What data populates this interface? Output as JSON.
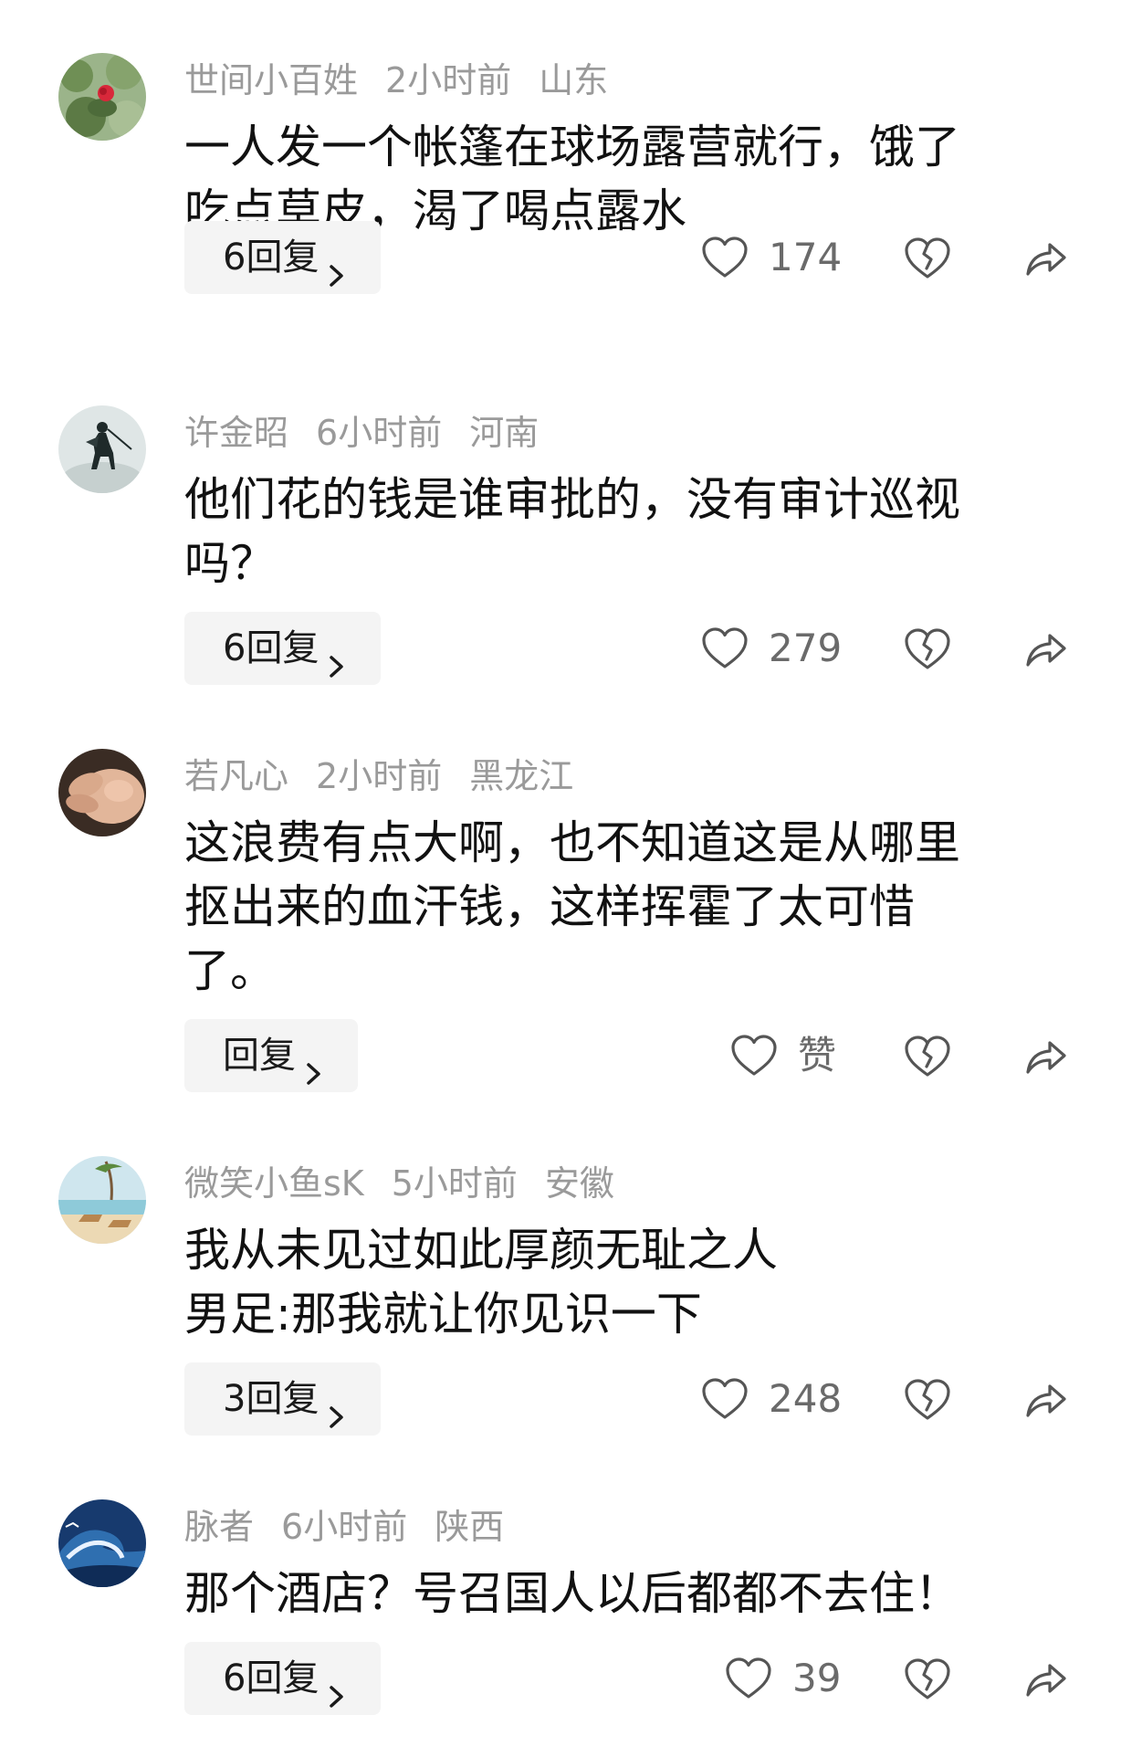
{
  "comments": [
    {
      "username": "世间小百姓",
      "time": "2小时前",
      "location": "山东",
      "text": "一人发一个帐篷在球场露营就行，饿了\n吃点草皮，渴了喝点露水",
      "reply_label": "6回复",
      "like_count": "174",
      "avatar_icon": "rose-flower-avatar"
    },
    {
      "username": "许金昭",
      "time": "6小时前",
      "location": "河南",
      "text": "他们花的钱是谁审批的，没有审计巡视\n吗？",
      "reply_label": "6回复",
      "like_count": "279",
      "avatar_icon": "horse-rider-avatar"
    },
    {
      "username": "若凡心",
      "time": "2小时前",
      "location": "黑龙江",
      "text": "这浪费有点大啊，也不知道这是从哪里\n抠出来的血汗钱，这样挥霍了太可惜\n了。",
      "reply_label": "回复",
      "like_count": "赞",
      "avatar_icon": "baby-hand-avatar"
    },
    {
      "username": "微笑小鱼sK",
      "time": "5小时前",
      "location": "安徽",
      "text": "我从未见过如此厚颜无耻之人\n男足:那我就让你见识一下",
      "reply_label": "3回复",
      "like_count": "248",
      "avatar_icon": "beach-chairs-avatar"
    },
    {
      "username": "脉者",
      "time": "6小时前",
      "location": "陕西",
      "text": "那个酒店？号召国人以后都都不去住！",
      "reply_label": "6回复",
      "like_count": "39",
      "avatar_icon": "ocean-wave-avatar"
    }
  ],
  "icons": {
    "like": "heart-outline-icon",
    "dislike": "broken-heart-icon",
    "share": "share-arrow-icon",
    "chevron": "chevron-right-icon"
  },
  "colors": {
    "meta_text": "#9a9a9a",
    "body_text": "#111111",
    "reply_bg": "#f4f4f4",
    "icon": "#555555"
  }
}
